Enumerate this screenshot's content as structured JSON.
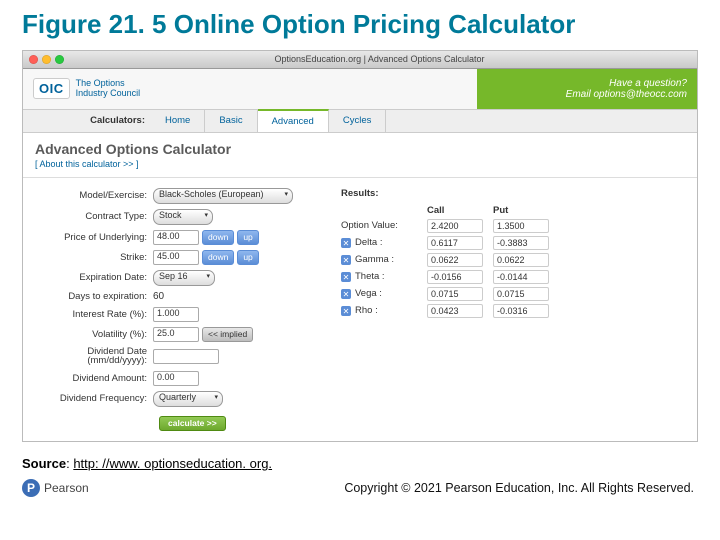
{
  "title": "Figure 21. 5 Online Option Pricing Calculator",
  "browser": {
    "windowTitle": "OptionsEducation.org | Advanced Options Calculator",
    "dots": [
      "#ff5f57",
      "#ffbd2e",
      "#28c940"
    ]
  },
  "brand": {
    "logo": "OIC",
    "tagline1": "The Options",
    "tagline2": "Industry Council",
    "question": "Have a question?",
    "email": "Email options@theocc.com"
  },
  "tabs": {
    "label": "Calculators:",
    "items": [
      "Home",
      "Basic",
      "Advanced",
      "Cycles"
    ],
    "active": 2
  },
  "calc": {
    "heading": "Advanced Options Calculator",
    "about": "[ About this calculator >> ]",
    "fields": {
      "model_label": "Model/Exercise:",
      "model_value": "Black-Scholes (European)",
      "ctype_label": "Contract Type:",
      "ctype_value": "Stock",
      "price_label": "Price of Underlying:",
      "price_value": "48.00",
      "strike_label": "Strike:",
      "strike_value": "45.00",
      "exp_label": "Expiration Date:",
      "exp_value": "Sep 16",
      "days_label": "Days to expiration:",
      "days_value": "60",
      "rate_label": "Interest Rate (%):",
      "rate_value": "1.000",
      "vol_label": "Volatility (%):",
      "vol_value": "25.0",
      "divdate_label": "Dividend Date (mm/dd/yyyy):",
      "divdate_value": "",
      "divamt_label": "Dividend Amount:",
      "divamt_value": "0.00",
      "divfreq_label": "Dividend Frequency:",
      "divfreq_value": "Quarterly"
    },
    "buttons": {
      "down": "down",
      "up": "up",
      "implied": "<< implied",
      "calc": "calculate >>"
    },
    "results": {
      "label": "Results:",
      "cols": [
        "",
        "Call",
        "Put"
      ],
      "rows": [
        {
          "name": "Option Value:",
          "call": "2.4200",
          "put": "1.3500",
          "greek": false
        },
        {
          "name": "Delta :",
          "call": "0.6117",
          "put": "-0.3883",
          "greek": true
        },
        {
          "name": "Gamma :",
          "call": "0.0622",
          "put": "0.0622",
          "greek": true
        },
        {
          "name": "Theta :",
          "call": "-0.0156",
          "put": "-0.0144",
          "greek": true
        },
        {
          "name": "Vega :",
          "call": "0.0715",
          "put": "0.0715",
          "greek": true
        },
        {
          "name": "Rho :",
          "call": "0.0423",
          "put": "-0.0316",
          "greek": true
        }
      ]
    }
  },
  "source": {
    "label": "Source",
    "colon": ": ",
    "link": "http: //www. optionseducation. org."
  },
  "footer": {
    "pearson": "Pearson",
    "copyright": "Copyright © 2021 Pearson Education, Inc. All Rights Reserved."
  }
}
